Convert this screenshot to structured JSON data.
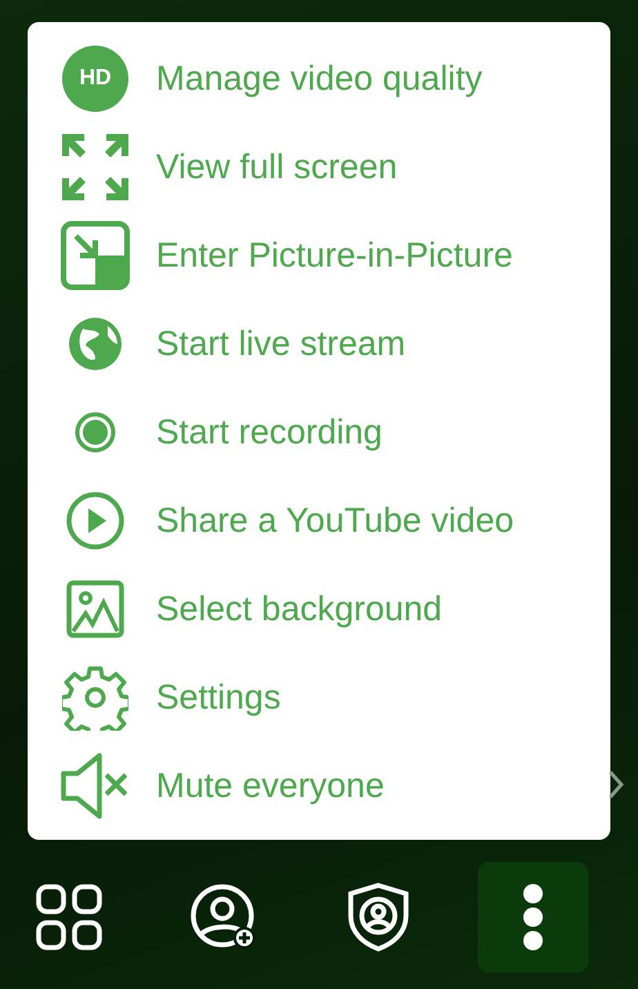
{
  "menu": {
    "items": [
      {
        "kind": "hd",
        "label": "Manage video quality",
        "icon_text": "HD"
      },
      {
        "kind": "fullscreen",
        "label": "View full screen"
      },
      {
        "kind": "pip",
        "label": "Enter Picture-in-Picture"
      },
      {
        "kind": "globe",
        "label": "Start live stream"
      },
      {
        "kind": "record",
        "label": "Start recording"
      },
      {
        "kind": "play",
        "label": "Share a YouTube video"
      },
      {
        "kind": "image",
        "label": "Select background"
      },
      {
        "kind": "gear",
        "label": "Settings"
      },
      {
        "kind": "mute",
        "label": "Mute everyone"
      }
    ]
  },
  "toolbar": {
    "buttons": [
      {
        "kind": "grid",
        "selected": false
      },
      {
        "kind": "add-person",
        "selected": false
      },
      {
        "kind": "shield",
        "selected": false
      },
      {
        "kind": "more",
        "selected": true
      }
    ]
  }
}
